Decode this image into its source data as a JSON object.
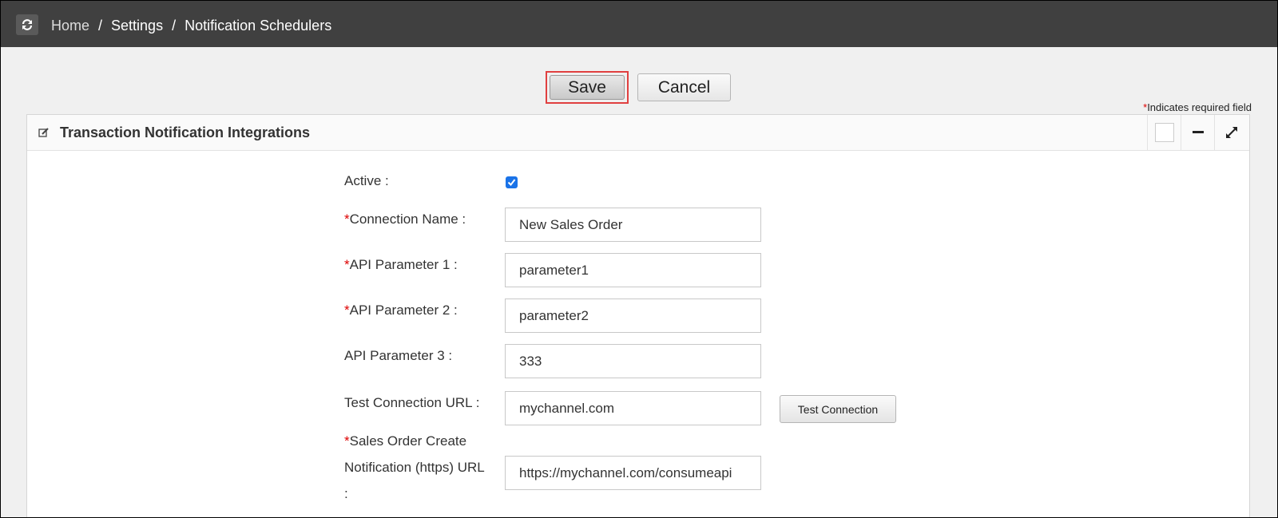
{
  "breadcrumb": {
    "home": "Home",
    "separator": "/",
    "settings": "Settings",
    "current": "Notification Schedulers"
  },
  "actions": {
    "save_label": "Save",
    "cancel_label": "Cancel"
  },
  "required_note": {
    "star": "*",
    "text": "Indicates required field"
  },
  "panel": {
    "title": "Transaction Notification Integrations"
  },
  "form": {
    "required_marker": "*",
    "active": {
      "label": "Active :",
      "checked": true
    },
    "connection_name": {
      "label": "Connection Name :",
      "value": "New Sales Order",
      "required": true
    },
    "api_param_1": {
      "label": "API Parameter 1 :",
      "value": "parameter1",
      "required": true
    },
    "api_param_2": {
      "label": "API Parameter 2 :",
      "value": "parameter2",
      "required": true
    },
    "api_param_3": {
      "label": "API Parameter 3 :",
      "value": "333",
      "required": false
    },
    "test_connection_url": {
      "label": "Test Connection URL :",
      "value": "mychannel.com",
      "required": false
    },
    "test_connection_button": "Test Connection",
    "sales_order_url": {
      "label_line1": "Sales Order Create",
      "label_line2": "Notification (https) URL",
      "label_line3": ":",
      "value": "https://mychannel.com/consumeapi",
      "required": true
    }
  },
  "colors": {
    "topbar": "#404040",
    "save_highlight": "#e04040",
    "required": "#dd0000",
    "checkbox": "#1a73e8"
  },
  "icons": [
    "refresh-icon",
    "edit-icon",
    "minimize-icon",
    "expand-icon",
    "checkmark-icon"
  ]
}
